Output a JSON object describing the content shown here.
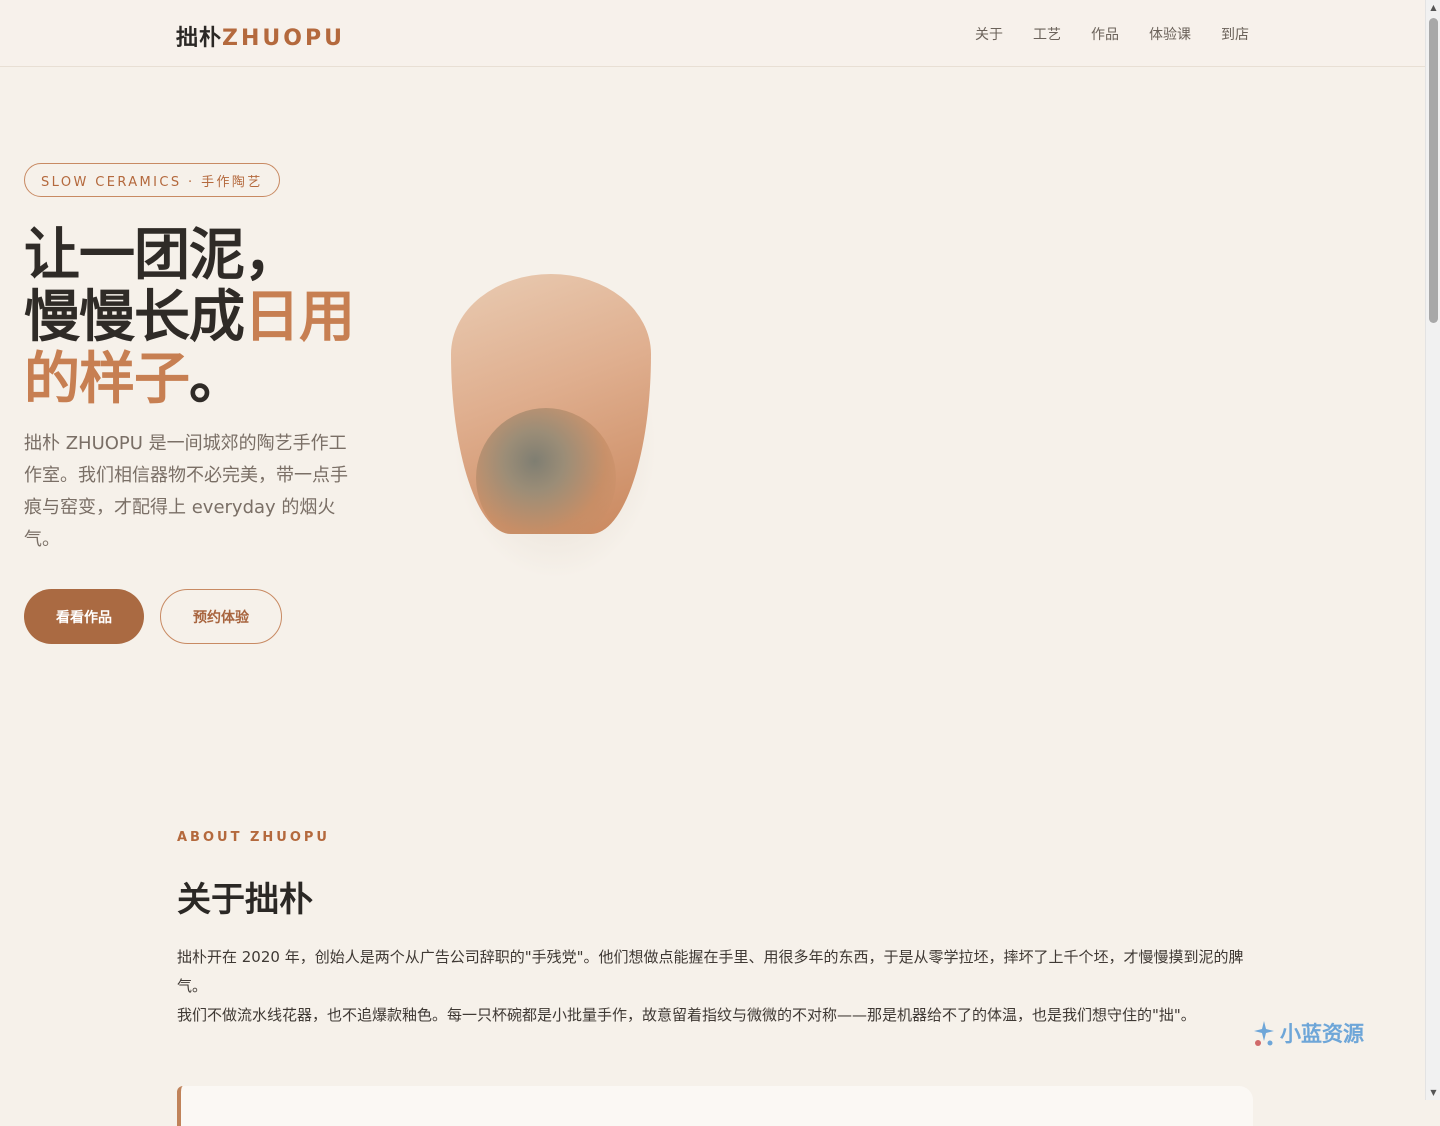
{
  "header": {
    "logo_cn": "拙朴",
    "logo_en": "ZHUOPU",
    "nav": [
      "关于",
      "工艺",
      "作品",
      "体验课",
      "到店"
    ]
  },
  "hero": {
    "tag": "SLOW CERAMICS · 手作陶艺",
    "title_line1": "让一团泥，",
    "title_line2_plain": "慢慢长成",
    "title_line2_accent": "日用",
    "title_line3_accent": "的样子",
    "title_line3_end": "。",
    "description": "拙朴 ZHUOPU 是一间城郊的陶艺手作工作室。我们相信器物不必完美，带一点手痕与窑变，才配得上 everyday 的烟火气。",
    "primary_button": "看看作品",
    "secondary_button": "预约体验"
  },
  "about": {
    "eyebrow": "ABOUT ZHUOPU",
    "title": "关于拙朴",
    "paragraph1": "拙朴开在 2020 年，创始人是两个从广告公司辞职的\"手残党\"。他们想做点能握在手里、用很多年的东西，于是从零学拉坯，摔坏了上千个坯，才慢慢摸到泥的脾气。",
    "paragraph2": "我们不做流水线花器，也不追爆款釉色。每一只杯碗都是小批量手作，故意留着指纹与微微的不对称——那是机器给不了的体温，也是我们想守住的\"拙\"。"
  },
  "watermark": {
    "text": "小蓝资源",
    "icon": "sparkle-icon"
  },
  "colors": {
    "accent": "#b4693d",
    "accent_light": "#c77f52",
    "button": "#aa6a42",
    "background": "#f6f1ea"
  }
}
